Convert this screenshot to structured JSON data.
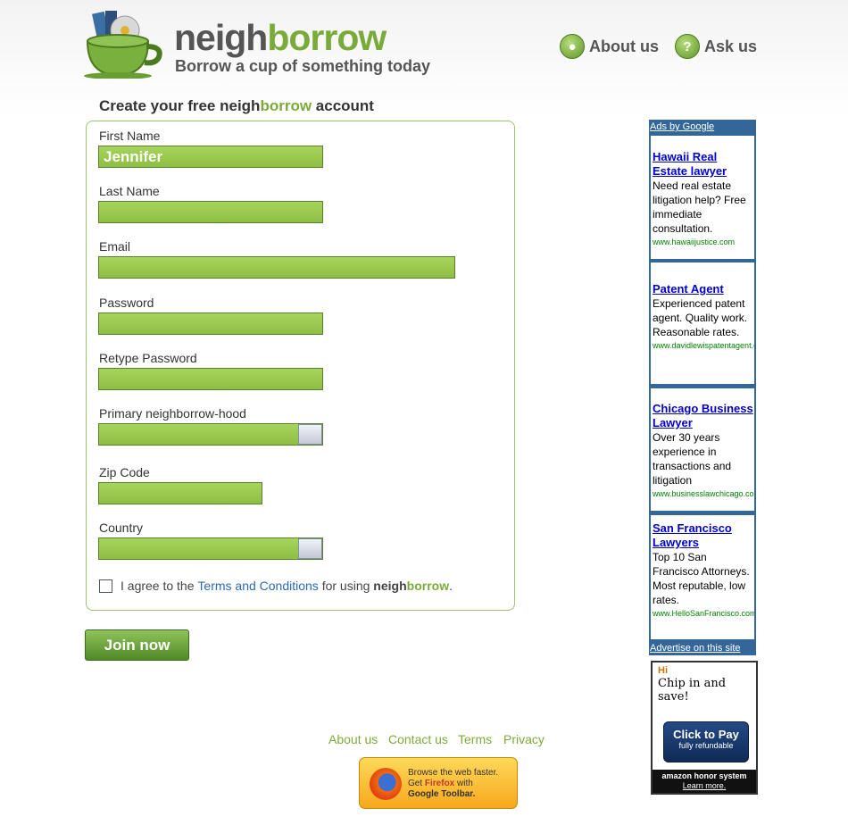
{
  "header": {
    "logo_part1": "neigh",
    "logo_part2": "borrow",
    "tagline": "Borrow a cup of something today",
    "nav_about": "About us",
    "nav_ask": "Ask us"
  },
  "form": {
    "title_pre": "Create your free neigh",
    "title_brand": "borrow",
    "title_post": " account",
    "first_name_label": "First Name",
    "first_name_value": "Jennifer",
    "last_name_label": "Last Name",
    "last_name_value": "",
    "email_label": "Email",
    "email_value": "",
    "password_label": "Password",
    "retype_label": "Retype Password",
    "hood_label": "Primary neighborrow-hood",
    "hood_value": "",
    "zip_label": "Zip Code",
    "zip_value": "",
    "country_label": "Country",
    "country_value": "",
    "agree_pre": "I agree to the ",
    "agree_link": "Terms and Conditions",
    "agree_mid": " for using ",
    "agree_brand1": "neigh",
    "agree_brand2": "borrow",
    "agree_end": ".",
    "join_label": "Join now"
  },
  "footer": {
    "about": "About us",
    "contact": "Contact us",
    "terms": "Terms",
    "privacy": "Privacy",
    "ff_line1": "Browse the web faster.",
    "ff_line2a": "Get ",
    "ff_line2b": "Firefox",
    "ff_line2c": " with",
    "ff_line3": "Google Toolbar."
  },
  "ads": {
    "header": "Ads by Google",
    "footer": "Advertise on this site",
    "items": [
      {
        "title": "Hawaii Real Estate lawyer",
        "desc": "Need real estate litigation help? Free immediate consultation.",
        "url": "www.hawaiijustice.com"
      },
      {
        "title": "Patent Agent",
        "desc": "Experienced patent agent. Quality work. Reasonable rates.",
        "url": "www.davidlewispatentagent.com"
      },
      {
        "title": "Chicago Business Lawyer",
        "desc": "Over 30 years experience in transactions and litigation",
        "url": "www.businesslawchicago.com"
      },
      {
        "title": "San Francisco Lawyers",
        "desc": "Top 10 San Francisco Attorneys. Most reputable, low rates.",
        "url": "www.HelloSanFrancisco.com"
      }
    ]
  },
  "amazon": {
    "hi": "Hi",
    "chip": "Chip in and save!",
    "pay_main": "Click to Pay",
    "pay_sub": "fully refundable",
    "bar_main": "amazon honor system",
    "bar_link": "Learn more."
  }
}
